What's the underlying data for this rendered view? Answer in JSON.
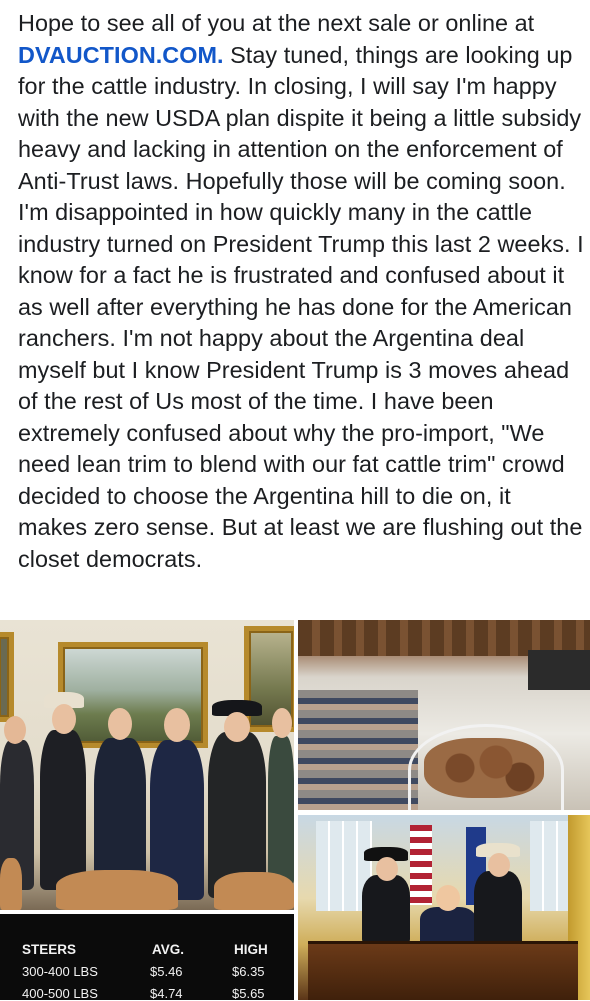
{
  "post": {
    "intro": "Hope to see all of you at the next sale or online at",
    "link": "DVAUCTION.COM.",
    "body": "Stay tuned,  things are looking up for the cattle industry.  In closing,  I will say I'm happy with the new USDA plan dispite it being a little subsidy heavy and lacking in attention on the enforcement of Anti-Trust laws. Hopefully those will be coming soon.  I'm disappointed in how quickly many in the cattle industry turned on President Trump this last 2 weeks.  I know for a fact he is frustrated and confused about it as well after everything he has done for the American ranchers. I'm not happy about the Argentina deal myself but I know President Trump is 3 moves ahead of the rest of Us most of the time.  I have been extremely confused about why the pro-import,  \"We need lean trim to blend with our fat cattle trim\" crowd decided to choose the Argentina hill to die on, it makes zero sense.  But at least we are flushing out the closet democrats."
  },
  "price_table": {
    "headers": [
      "STEERS",
      "AVG.",
      "HIGH"
    ],
    "rows": [
      [
        "300-400 LBS",
        "$5.46",
        "$6.35"
      ],
      [
        "400-500 LBS",
        "$4.74",
        "$5.65"
      ]
    ]
  },
  "colors": {
    "link": "#1257c9",
    "text": "#1c1e21",
    "table_bg": "#0b0b0b"
  },
  "images": {
    "meeting": "photo-men-in-suits-meeting-room",
    "barn": "photo-cattle-auction-sale-barn",
    "office": "photo-oval-office-group"
  }
}
